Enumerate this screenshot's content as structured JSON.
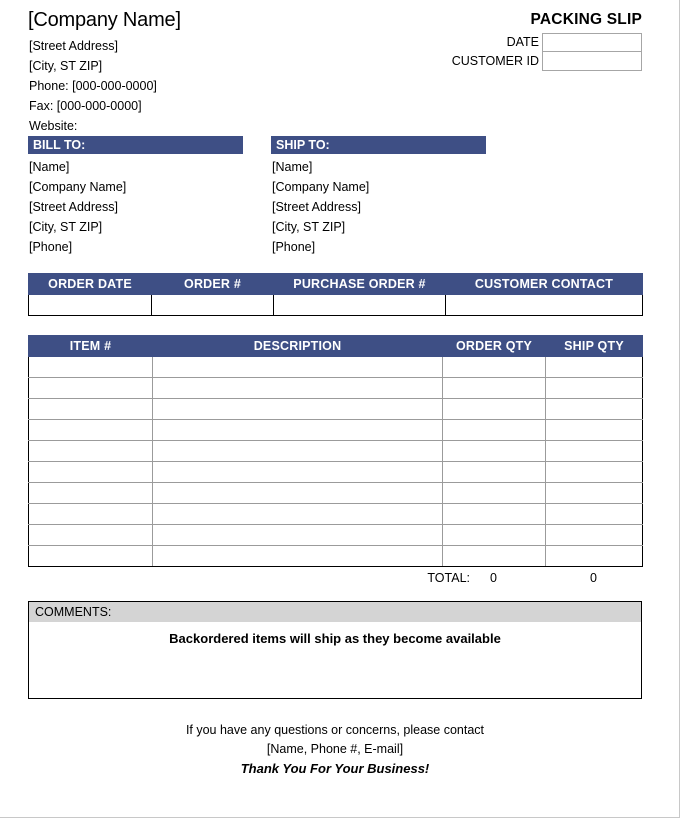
{
  "document": {
    "title": "PACKING SLIP"
  },
  "company": {
    "name": "[Company Name]",
    "lines": [
      "[Street Address]",
      "[City, ST  ZIP]",
      "Phone: [000-000-0000]",
      "Fax: [000-000-0000]",
      "Website:"
    ]
  },
  "meta": {
    "fields": [
      {
        "label": "DATE",
        "value": ""
      },
      {
        "label": "CUSTOMER ID",
        "value": ""
      }
    ]
  },
  "addresses": {
    "bill": {
      "heading": "BILL TO:",
      "lines": [
        "[Name]",
        "[Company Name]",
        "[Street Address]",
        "[City, ST  ZIP]",
        "[Phone]"
      ]
    },
    "ship": {
      "heading": "SHIP TO:",
      "lines": [
        "[Name]",
        "[Company Name]",
        "[Street Address]",
        "[City, ST  ZIP]",
        "[Phone]"
      ]
    }
  },
  "order_table": {
    "headers": [
      "ORDER DATE",
      "ORDER #",
      "PURCHASE ORDER #",
      "CUSTOMER CONTACT"
    ],
    "rows": [
      [
        "",
        "",
        "",
        ""
      ]
    ]
  },
  "items_table": {
    "headers": [
      "ITEM #",
      "DESCRIPTION",
      "ORDER QTY",
      "SHIP QTY"
    ],
    "rows": [
      [
        "",
        "",
        "",
        ""
      ],
      [
        "",
        "",
        "",
        ""
      ],
      [
        "",
        "",
        "",
        ""
      ],
      [
        "",
        "",
        "",
        ""
      ],
      [
        "",
        "",
        "",
        ""
      ],
      [
        "",
        "",
        "",
        ""
      ],
      [
        "",
        "",
        "",
        ""
      ],
      [
        "",
        "",
        "",
        ""
      ],
      [
        "",
        "",
        "",
        ""
      ],
      [
        "",
        "",
        "",
        ""
      ]
    ]
  },
  "totals": {
    "label": "TOTAL:",
    "order_qty": "0",
    "ship_qty": "0"
  },
  "comments": {
    "heading": "COMMENTS:",
    "message": "Backordered items will ship as they become available"
  },
  "footer": {
    "line1": "If you have any questions or concerns, please contact",
    "line2": "[Name, Phone #, E-mail]",
    "thanks": "Thank You For Your Business!"
  },
  "colors": {
    "header_navy": "#3e4f85",
    "comments_gray": "#d4d4d4"
  }
}
